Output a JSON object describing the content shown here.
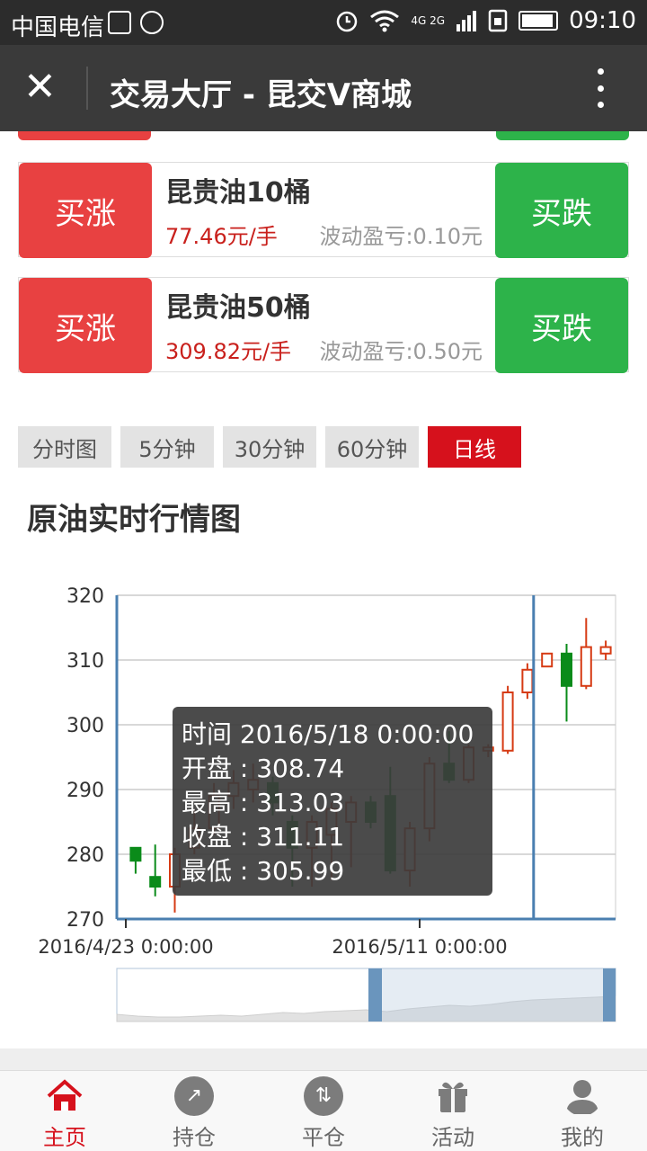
{
  "status_bar": {
    "carrier": "中国电信",
    "network": "4G 2G",
    "time": "09:10"
  },
  "title_bar": {
    "title": "交易大厅 - 昆交V商城"
  },
  "products": [
    {
      "buy_up_label": "买涨",
      "name": "昆贵油10桶",
      "price": "77.46元/手",
      "float": "波动盈亏:0.10元",
      "buy_down_label": "买跌"
    },
    {
      "buy_up_label": "买涨",
      "name": "昆贵油50桶",
      "price": "309.82元/手",
      "float": "波动盈亏:0.50元",
      "buy_down_label": "买跌"
    }
  ],
  "timeframe_tabs": [
    {
      "label": "分时图",
      "active": false
    },
    {
      "label": "5分钟",
      "active": false
    },
    {
      "label": "30分钟",
      "active": false
    },
    {
      "label": "60分钟",
      "active": false
    },
    {
      "label": "日线",
      "active": true
    }
  ],
  "chart_title": "原油实时行情图",
  "tooltip": {
    "time": "时间 2016/5/18 0:00:00",
    "open": "开盘 : 308.74",
    "high": "最高 : 313.03",
    "close": "收盘 : 311.11",
    "low": "最低 : 305.99"
  },
  "chart_data": {
    "type": "candlestick",
    "title": "原油实时行情图",
    "ylim": [
      270,
      320
    ],
    "y_ticks": [
      "320",
      "310",
      "300",
      "290",
      "280",
      "270"
    ],
    "x_tick_labels": [
      "2016/4/23 0:00:00",
      "2016/5/11 0:00:00"
    ],
    "colors": {
      "up": "#d63b14",
      "down": "#0a8b1a"
    },
    "candles": [
      {
        "open": 281,
        "close": 279,
        "high": 281,
        "low": 277
      },
      {
        "open": 276.5,
        "close": 275,
        "high": 281.5,
        "low": 273.5
      },
      {
        "open": 275,
        "close": 280,
        "high": 281,
        "low": 271
      },
      {
        "open": 281,
        "close": 284,
        "high": 287,
        "low": 280
      },
      {
        "open": 284,
        "close": 289,
        "high": 291,
        "low": 283
      },
      {
        "open": 289,
        "close": 291,
        "high": 293,
        "low": 287
      },
      {
        "open": 290,
        "close": 291.5,
        "high": 294,
        "low": 288
      },
      {
        "open": 291,
        "close": 288,
        "high": 292,
        "low": 286
      },
      {
        "open": 285,
        "close": 281,
        "high": 286,
        "low": 275
      },
      {
        "open": 281,
        "close": 285,
        "high": 286,
        "low": 275
      },
      {
        "open": 283,
        "close": 287,
        "high": 288,
        "low": 276
      },
      {
        "open": 285,
        "close": 288,
        "high": 289,
        "low": 278
      },
      {
        "open": 288,
        "close": 285,
        "high": 289,
        "low": 284
      },
      {
        "open": 289,
        "close": 277.5,
        "high": 293.5,
        "low": 277
      },
      {
        "open": 277.5,
        "close": 284,
        "high": 285,
        "low": 275
      },
      {
        "open": 284,
        "close": 294,
        "high": 295,
        "low": 282
      },
      {
        "open": 294,
        "close": 291.5,
        "high": 299,
        "low": 291
      },
      {
        "open": 291.5,
        "close": 296.5,
        "high": 297,
        "low": 291
      },
      {
        "open": 296,
        "close": 296.5,
        "high": 297,
        "low": 295
      },
      {
        "open": 296,
        "close": 305,
        "high": 306,
        "low": 295.5
      },
      {
        "open": 305,
        "close": 308.5,
        "high": 309.5,
        "low": 304
      },
      {
        "open": 309,
        "close": 311,
        "high": 311,
        "low": 309
      },
      {
        "open": 311,
        "close": 306,
        "high": 312.5,
        "low": 300.5
      },
      {
        "open": 306,
        "close": 312,
        "high": 316.5,
        "low": 305.5
      },
      {
        "open": 311,
        "close": 312,
        "high": 313,
        "low": 310
      }
    ],
    "navigator_series": [
      8,
      6,
      5,
      5,
      6,
      7,
      6,
      8,
      10,
      9,
      11,
      12,
      13,
      11,
      14,
      16,
      18,
      17,
      19,
      22,
      24,
      25,
      26,
      27,
      28
    ]
  },
  "bottom_nav": [
    {
      "label": "主页",
      "icon": "home-icon",
      "active": true
    },
    {
      "label": "持仓",
      "icon": "trend-icon",
      "active": false
    },
    {
      "label": "平仓",
      "icon": "swap-icon",
      "active": false
    },
    {
      "label": "活动",
      "icon": "gift-icon",
      "active": false
    },
    {
      "label": "我的",
      "icon": "user-icon",
      "active": false
    }
  ]
}
